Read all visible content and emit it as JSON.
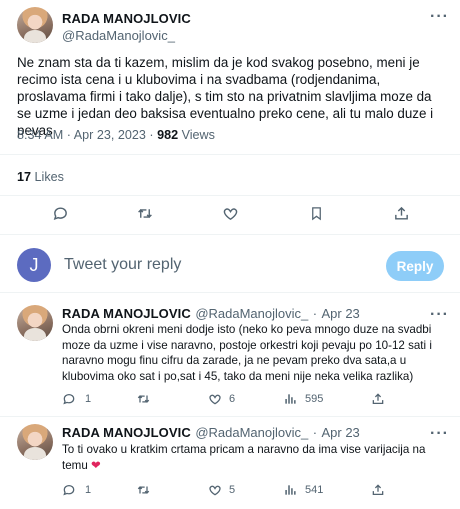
{
  "main_tweet": {
    "author_name": "RADA MANOJLOVIC",
    "author_handle": "@RadaManojlovic_",
    "text": "Ne znam sta da ti kazem, mislim da je kod svakog posebno, meni je recimo ista cena i u klubovima i na svadbama (rodjendanima, proslavama firmi i tako dalje), s tim sto na privatnim slavljima moze da se uzme i jedan deo baksisa eventualno preko cene, ali tu malo duze i pevas",
    "time": "8:34 AM",
    "date": "Apr 23, 2023",
    "views_count": "982",
    "views_label": "Views",
    "likes_count": "17",
    "likes_label": "Likes"
  },
  "composer": {
    "avatar_letter": "J",
    "avatar_color": "#5c6bc0",
    "placeholder": "Tweet your reply",
    "reply_label": "Reply"
  },
  "replies": [
    {
      "author_name": "RADA MANOJLOVIC",
      "author_handle": "@RadaManojlovic_",
      "date": "Apr 23",
      "text": "Onda obrni okreni meni dodje isto (neko ko peva mnogo duze na svadbi moze da uzme i vise naravno, postoje orkestri koji pevaju po 10-12 sati i naravno mogu finu cifru da zarade, ja ne pevam preko dva sata,a u klubovima oko sat i po,sat i 45, tako da meni nije neka velika razlika)",
      "replies": "1",
      "retweets": "",
      "likes": "6",
      "views": "595"
    },
    {
      "author_name": "RADA MANOJLOVIC",
      "author_handle": "@RadaManojlovic_",
      "date": "Apr 23",
      "text": "To ti ovako u kratkim crtama pricam a naravno da ima vise varijacija na temu",
      "emoji": "❤",
      "replies": "1",
      "retweets": "",
      "likes": "5",
      "views": "541"
    }
  ],
  "separator": "·",
  "icons": [
    "more-icon",
    "reply-icon",
    "retweet-icon",
    "like-icon",
    "bookmark-icon",
    "share-icon",
    "views-icon"
  ],
  "colors": {
    "accent": "#1d9bf0",
    "reply_button": "#8ecdf8",
    "text_secondary": "#536471",
    "heart": "#e0245e"
  }
}
